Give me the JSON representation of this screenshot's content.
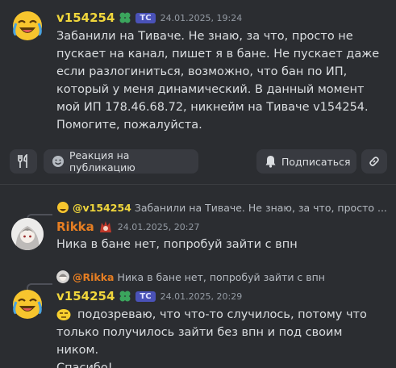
{
  "messages": [
    {
      "username": "v154254",
      "tag": "TC",
      "timestamp": "24.01.2025, 19:24",
      "lines": [
        "Забанили на Тиваче. Не знаю, за что, просто не",
        "пускает на канал, пишет я в бане. Не пускает даже",
        "если разлогиниться, возможно, что бан по ИП,",
        "который у меня динамический.  В данный момент",
        "мой ИП 178.46.68.72, никнейм на Тиваче v154254.",
        "Помогите, пожалуйста."
      ]
    },
    {
      "reply_mention": "@v154254",
      "reply_text": "Забанили на Тиваче. Не знаю, за что, просто ...",
      "username": "Rikka",
      "timestamp": "24.01.2025, 20:27",
      "lines": [
        "Ника в бане нет, попробуй зайти с впн"
      ]
    },
    {
      "reply_mention": "@Rikka",
      "reply_text": "Ника в бане нет, попробуй зайти с впн",
      "username": "v154254",
      "tag": "TC",
      "timestamp": "24.01.2025, 20:29",
      "lines": [
        "подозреваю, что что-то случилось, потому что",
        "только получилось зайти без впн и под своим ником.",
        "Спасибо!..."
      ]
    }
  ],
  "toolbar": {
    "react_label": "Реакция на публикацию",
    "follow_label": "Подписаться"
  },
  "icons": {
    "utensils": "utensils-icon",
    "smile": "smile-icon",
    "bell": "bell-icon",
    "link": "link-icon",
    "clover": "clover-icon"
  },
  "colors": {
    "background": "#2b2d31",
    "username_yellow": "#f0d63c",
    "username_orange": "#e67e22",
    "tag_bg": "#4a52b8"
  }
}
